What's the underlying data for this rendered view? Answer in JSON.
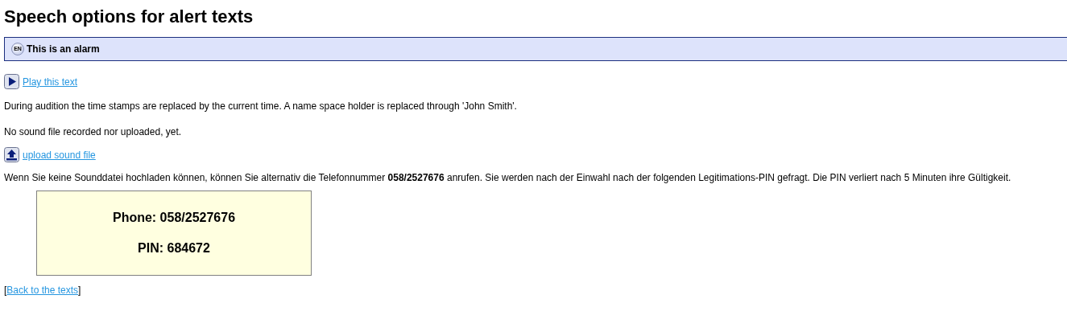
{
  "title": "Speech options for alert texts",
  "alert": {
    "language_badge": "EN",
    "text": "This is an alarm"
  },
  "play_link": "Play this text",
  "audition_note": "During audition the time stamps are replaced by the current time. A name space holder is replaced through 'John Smith'.",
  "sound_status": "No sound file recorded nor uploaded, yet.",
  "upload_link": "upload sound file",
  "phone_note": "Wenn Sie keine Sounddatei hochladen können, können Sie alternativ die Telefonnummer **058/2527676** anrufen. Sie werden nach der Einwahl nach der folgenden Legitimations-PIN gefragt. Die PIN verliert nach 5 Minuten ihre Gültigkeit.",
  "dial_box": {
    "phone": "Phone: 058/2527676",
    "pin": "PIN: 684672"
  },
  "back_link": {
    "open": "[",
    "label": "Back to the texts",
    "close": "]"
  }
}
